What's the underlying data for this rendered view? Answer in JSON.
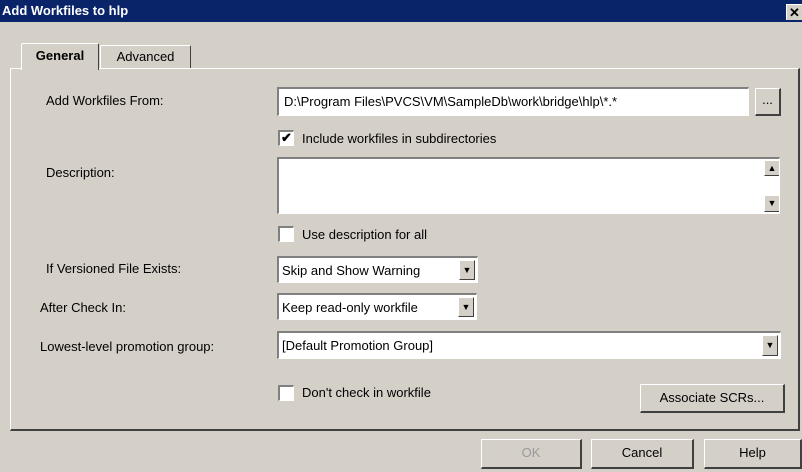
{
  "window": {
    "title": "Add Workfiles to hlp",
    "close_glyph": "✕"
  },
  "tabs": [
    {
      "label": "General",
      "active": true
    },
    {
      "label": "Advanced",
      "active": false
    }
  ],
  "form": {
    "add_from_label": "Add Workfiles From:",
    "add_from_value": "D:\\Program Files\\PVCS\\VM\\SampleDb\\work\\bridge\\hlp\\*.*",
    "browse_label": "...",
    "include_subdirs_label": "Include workfiles in subdirectories",
    "include_subdirs_checked": true,
    "description_label": "Description:",
    "description_value": "",
    "use_desc_all_label": "Use description for all",
    "use_desc_all_checked": false,
    "if_exists_label": "If Versioned File Exists:",
    "if_exists_value": "Skip and Show Warning",
    "after_checkin_label": "After Check In:",
    "after_checkin_value": "Keep read-only workfile",
    "promo_label": "Lowest-level promotion group:",
    "promo_value": "[Default Promotion Group]",
    "dont_checkin_label": "Don't check in workfile",
    "dont_checkin_checked": false,
    "associate_label": "Associate SCRs..."
  },
  "footer": {
    "ok": "OK",
    "cancel": "Cancel",
    "help": "Help"
  },
  "glyphs": {
    "check": "✔",
    "down": "▼",
    "up": "▲"
  }
}
